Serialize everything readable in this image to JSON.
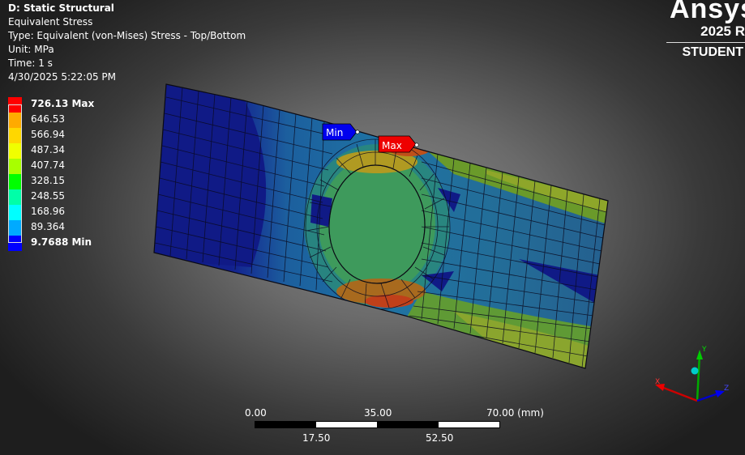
{
  "header": {
    "title": "D: Static Structural",
    "result": "Equivalent Stress",
    "type": "Type: Equivalent (von-Mises) Stress - Top/Bottom",
    "unit": "Unit: MPa",
    "time": "Time: 1 s",
    "timestamp": "4/30/2025 5:22:05 PM"
  },
  "logo": {
    "brand": "Ansys",
    "version": "2025 R",
    "edition": "STUDENT"
  },
  "legend": {
    "max_label": "726.13 Max",
    "min_label": "9.7688 Min",
    "levels": [
      "726.13 Max",
      "646.53",
      "566.94",
      "487.34",
      "407.74",
      "328.15",
      "248.55",
      "168.96",
      "89.364",
      "9.7688 Min"
    ],
    "colors": [
      "#ff0000",
      "#ffaa00",
      "#ffd700",
      "#f0ff00",
      "#a8ff00",
      "#00ff00",
      "#00ffa8",
      "#00ffff",
      "#00aaff",
      "#0000ff"
    ]
  },
  "probes": {
    "min_label": "Min",
    "max_label": "Max",
    "min_color": "#0000ff",
    "max_color": "#ff0000"
  },
  "scale_bar": {
    "top_ticks": [
      "0.00",
      "35.00",
      "70.00 (mm)"
    ],
    "bottom_ticks": [
      "17.50",
      "52.50"
    ]
  },
  "triad": {
    "x": "X",
    "y": "Y",
    "z": "Z"
  }
}
